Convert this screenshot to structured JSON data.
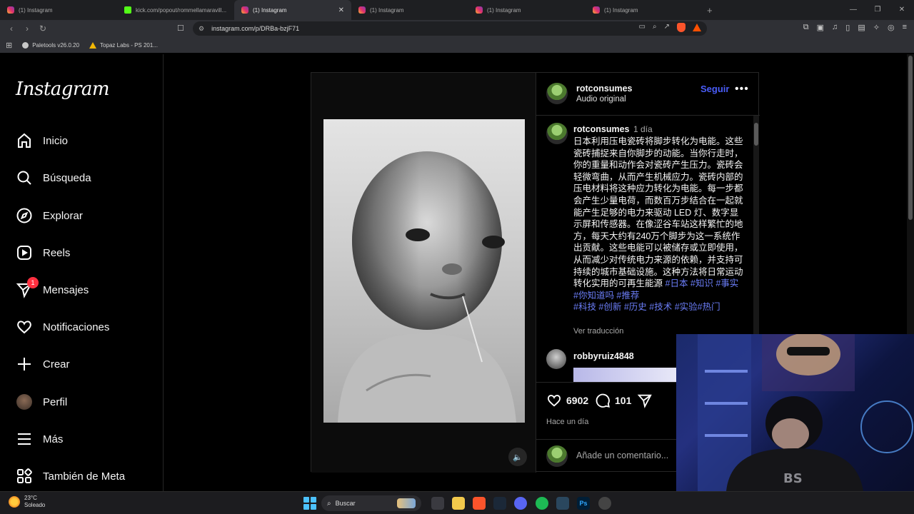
{
  "browser": {
    "tabs": [
      {
        "label": "(1) Instagram",
        "icon": "instagram"
      },
      {
        "label": "kick.com/popout/rommellamaravill...",
        "icon": "kick"
      },
      {
        "label": "(1) Instagram",
        "icon": "instagram",
        "active": true
      },
      {
        "label": "(1) Instagram",
        "icon": "instagram"
      },
      {
        "label": "(1) Instagram",
        "icon": "instagram"
      },
      {
        "label": "(1) Instagram",
        "icon": "instagram"
      }
    ],
    "url": "instagram.com/p/DRBa-bzjF71",
    "bookmarks": [
      {
        "label": "Paletools v26.0.20"
      },
      {
        "label": "Topaz Labs - PS 201..."
      }
    ]
  },
  "sidebar": {
    "logo": "Instagram",
    "items": [
      {
        "label": "Inicio",
        "icon": "home-icon"
      },
      {
        "label": "Búsqueda",
        "icon": "search-icon"
      },
      {
        "label": "Explorar",
        "icon": "compass-icon"
      },
      {
        "label": "Reels",
        "icon": "reels-icon"
      },
      {
        "label": "Mensajes",
        "icon": "messenger-icon",
        "badge": "1"
      },
      {
        "label": "Notificaciones",
        "icon": "heart-icon"
      },
      {
        "label": "Crear",
        "icon": "plus-icon"
      },
      {
        "label": "Perfil",
        "icon": "avatar"
      },
      {
        "label": "Más",
        "icon": "menu-icon"
      },
      {
        "label": "También de Meta",
        "icon": "meta-apps-icon"
      }
    ]
  },
  "post": {
    "author": "rotconsumes",
    "audio": "Audio original",
    "follow_label": "Seguir",
    "more_label": "•••",
    "caption_time": "1 día",
    "caption_text": "日本利用压电瓷砖将脚步转化为电能。这些瓷砖捕捉来自你脚步的动能。当你行走时，你的重量和动作会对瓷砖产生压力。瓷砖会轻微弯曲，从而产生机械应力。瓷砖内部的压电材料将这种应力转化为电能。每一步都会产生少量电荷，而数百万步结合在一起就能产生足够的电力来驱动 LED 灯、数字显示屏和传感器。在像涩谷车站这样繁忙的地方，每天大约有240万个脚步为这一系统作出贡献。这些电能可以被储存或立即使用，从而减少对传统电力来源的依赖，并支持可持续的城市基础设施。这种方法将日常运动转化实用的可再生能源",
    "hashtags_line1": " #日本 #知识 #事实 #你知道吗 #推荐",
    "hashtags_line2": "#科技 #创新 #历史 #技术 #实验#热门",
    "translate_label": "Ver traducción",
    "comment_user": "robbyruiz4848",
    "likes": "6902",
    "comments_count": "101",
    "posted_ago": "Hace un día",
    "comment_placeholder": "Añade un comentario..."
  },
  "taskbar": {
    "weather_temp": "23°C",
    "weather_desc": "Soleado",
    "search_label": "Buscar"
  },
  "colors": {
    "follow": "#4a5df9",
    "hashtag": "#6a7cf5",
    "badge": "#ff3040"
  }
}
